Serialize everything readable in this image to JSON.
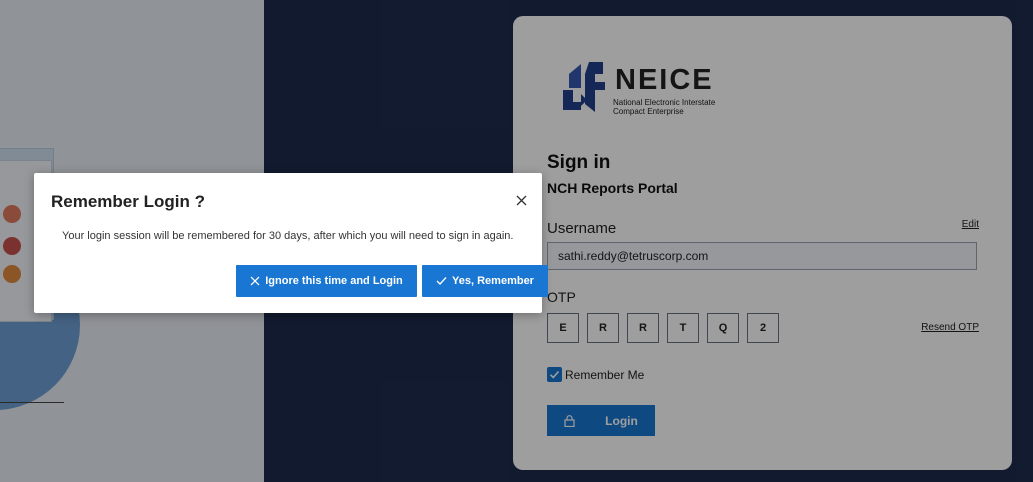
{
  "logo": {
    "word": "NEICE",
    "subtitle": "National Electronic Interstate Compact Enterprise"
  },
  "signin": {
    "title": "Sign in",
    "subtitle": "NCH Reports Portal",
    "username_label": "Username",
    "edit_link": "Edit",
    "username_value": "sathi.reddy@tetruscorp.com",
    "otp_label": "OTP",
    "otp_chars": [
      "E",
      "R",
      "R",
      "T",
      "Q",
      "2"
    ],
    "resend_link": "Resend OTP",
    "remember_me_label": "Remember Me",
    "remember_me_checked": true,
    "login_button": "Login"
  },
  "modal": {
    "title": "Remember Login ?",
    "message": "Your login session will be remembered for 30 days, after which you will need to sign in again.",
    "ignore_button": "Ignore this time and Login",
    "yes_button": "Yes, Remember"
  },
  "colors": {
    "primary": "#1976d2",
    "navy_background": "#1d2b4d",
    "overlay": "rgba(0,0,0,0.38)"
  },
  "icons": {
    "close": "close-icon",
    "x": "x-icon",
    "check": "check-icon",
    "lock": "lock-icon",
    "checkbox_check": "checkmark-icon"
  }
}
